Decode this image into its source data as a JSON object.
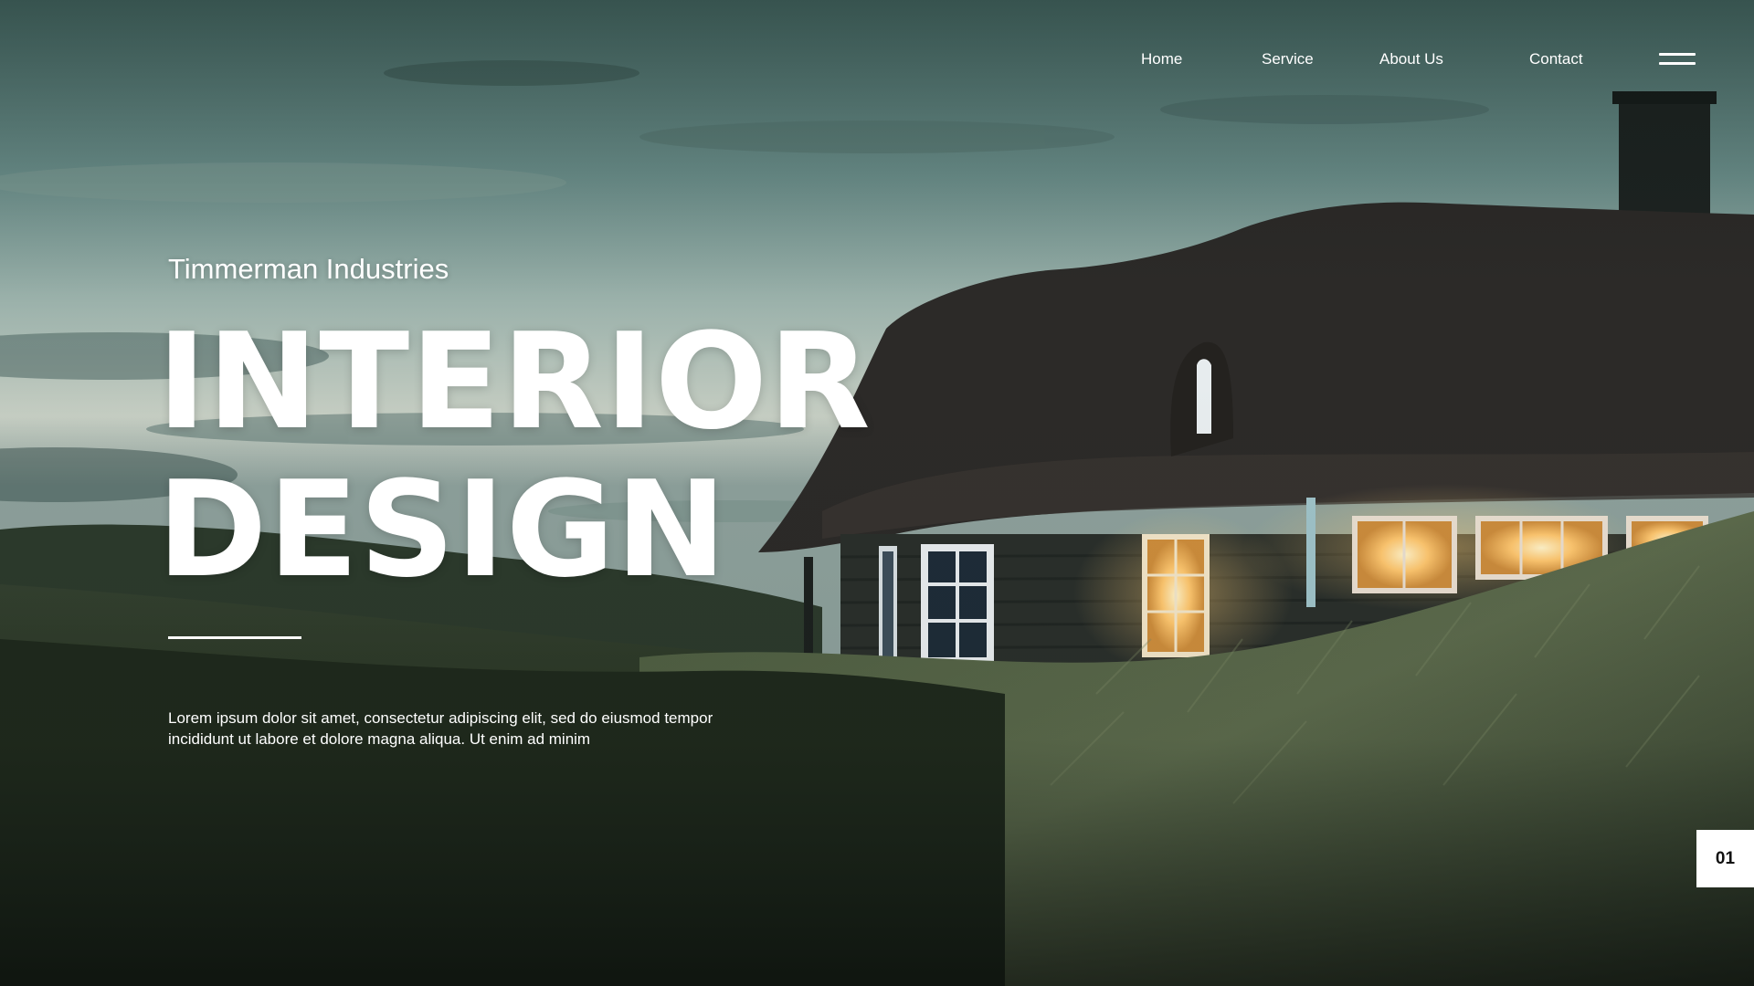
{
  "nav": {
    "items": [
      {
        "label": "Home"
      },
      {
        "label": "Service"
      },
      {
        "label": "About Us"
      },
      {
        "label": "Contact"
      }
    ],
    "menu_icon": "hamburger-menu-icon"
  },
  "hero": {
    "company": "Timmerman Industries",
    "headline_line1": "INTERIOR",
    "headline_line2": "DESIGN",
    "description": "Lorem ipsum dolor sit amet, consectetur adipiscing elit, sed do eiusmod tempor incididunt ut labore et dolore magna aliqua. Ut enim ad minim",
    "background": "photo-thatched-house-at-dusk"
  },
  "page_indicator": "01",
  "colors": {
    "text": "#ffffff",
    "indicator_bg": "#ffffff",
    "indicator_text": "#111111",
    "window_glow": "#ffc56a"
  }
}
